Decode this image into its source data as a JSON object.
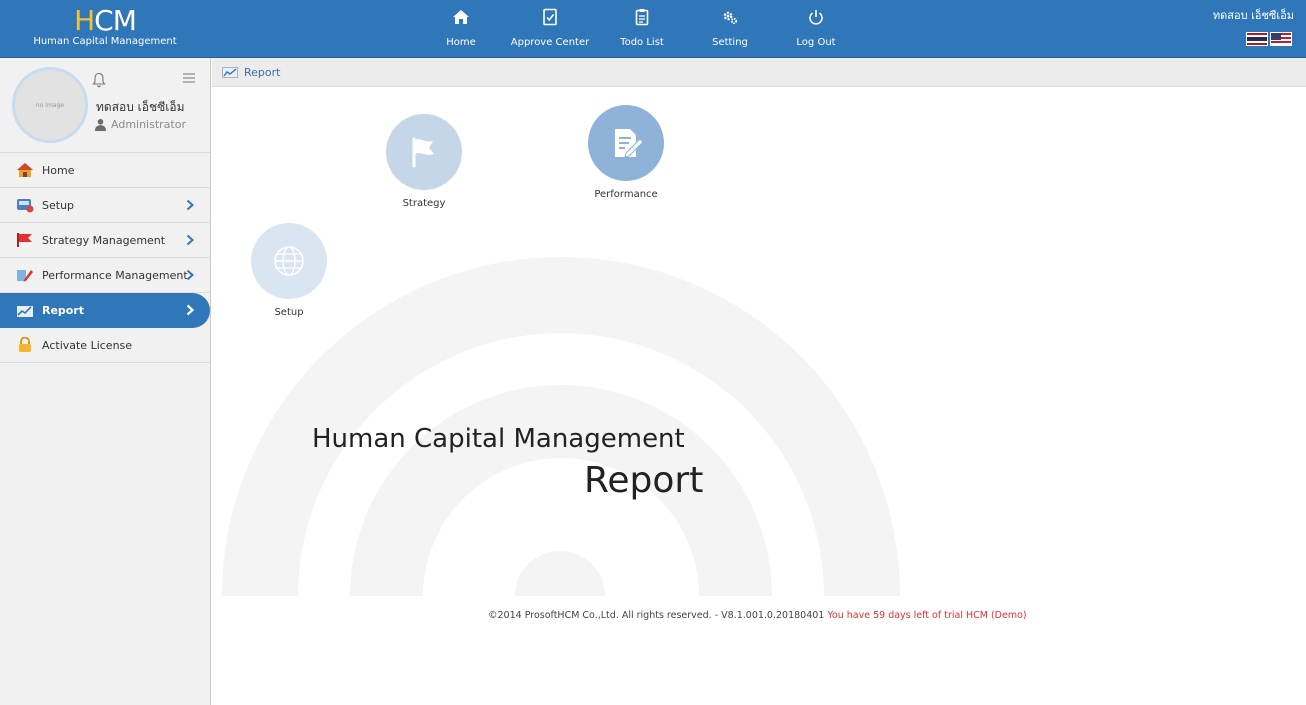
{
  "app": {
    "logo_text": "HCM",
    "logo_subtitle": "Human Capital Management"
  },
  "topnav": {
    "items": [
      {
        "label": "Home",
        "icon": "home-icon"
      },
      {
        "label": "Approve Center",
        "icon": "approve-icon"
      },
      {
        "label": "Todo List",
        "icon": "clipboard-icon"
      },
      {
        "label": "Setting",
        "icon": "gear-icon"
      },
      {
        "label": "Log Out",
        "icon": "power-icon"
      }
    ]
  },
  "user": {
    "name": "ทดสอบ เอ็ชซีเอ็ม",
    "role": "Administrator",
    "avatar_text": "no Image"
  },
  "sidebar": {
    "items": [
      {
        "label": "Home",
        "icon": "home-icon",
        "has_submenu": false,
        "active": false
      },
      {
        "label": "Setup",
        "icon": "setup-icon",
        "has_submenu": true,
        "active": false
      },
      {
        "label": "Strategy Management",
        "icon": "flag-icon",
        "has_submenu": true,
        "active": false
      },
      {
        "label": "Performance Management",
        "icon": "performance-icon",
        "has_submenu": true,
        "active": false
      },
      {
        "label": "Report",
        "icon": "report-icon",
        "has_submenu": true,
        "active": true
      },
      {
        "label": "Activate License",
        "icon": "lock-icon",
        "has_submenu": false,
        "active": false
      }
    ]
  },
  "breadcrumb": {
    "current": "Report"
  },
  "report_tiles": [
    {
      "label": "Strategy",
      "icon": "flag-icon"
    },
    {
      "label": "Performance",
      "icon": "document-edit-icon"
    },
    {
      "label": "Setup",
      "icon": "globe-icon"
    }
  ],
  "hero": {
    "line1": "Human Capital Management",
    "line2": "Report"
  },
  "footer": {
    "copyright": "©2014 ProsoftHCM Co.,Ltd. All rights reserved. - V8.1.001.0.20180401",
    "trial_notice": "You have 59 days left of trial HCM (Demo)"
  },
  "colors": {
    "primary": "#2f77b8",
    "tile_light": "#c5d6e8",
    "tile_strong": "#8fb3d8",
    "warning": "#e0312f"
  }
}
